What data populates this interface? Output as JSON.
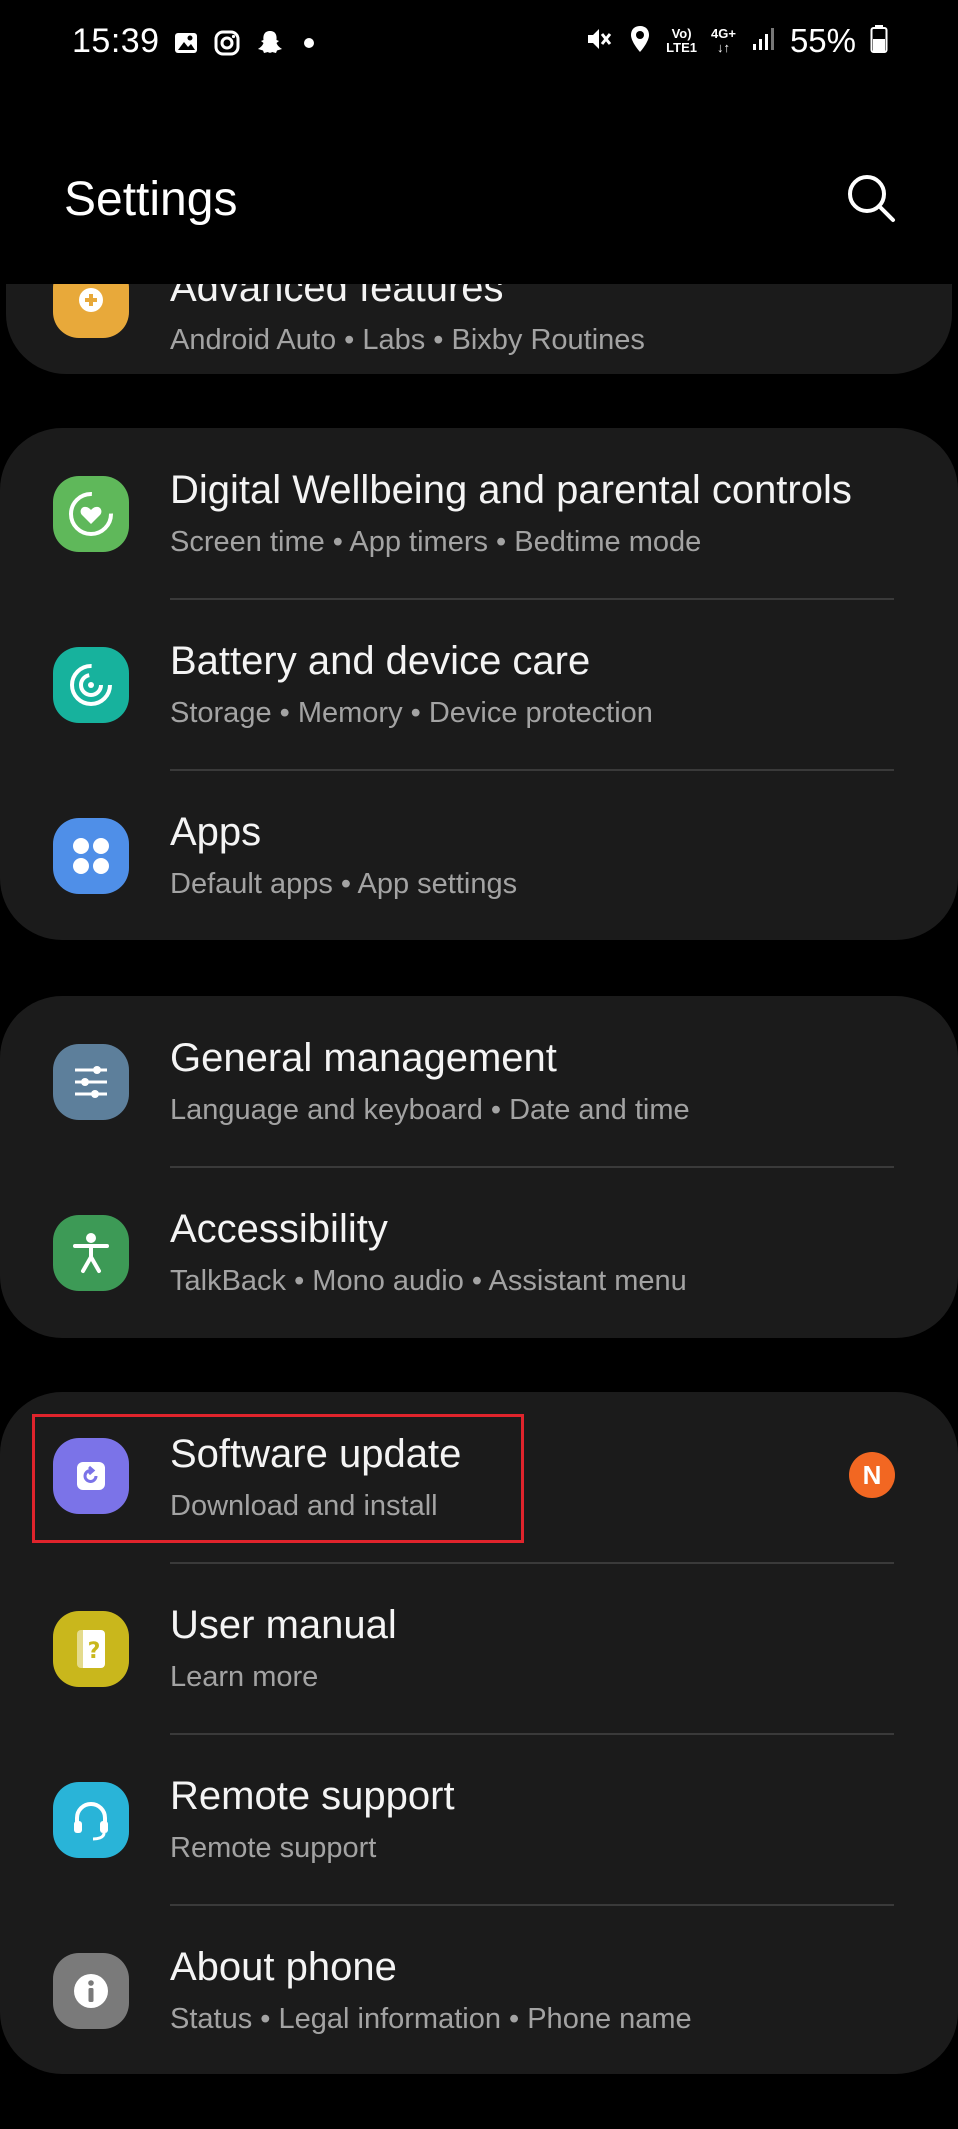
{
  "status_bar": {
    "time": "15:39",
    "battery_percent": "55%",
    "network_top": "Vo)",
    "network_bottom": "LTE1",
    "network_type": "4G+",
    "icons": [
      "gallery-icon",
      "instagram-icon",
      "snapchat-icon",
      "dot-icon",
      "mute-icon",
      "location-icon",
      "signal-icon",
      "battery-icon"
    ]
  },
  "header": {
    "title": "Settings"
  },
  "partial_item": {
    "title": "Advanced features",
    "subtitle": "Android Auto  •  Labs  •  Bixby Routines",
    "icon": "gear-plus-icon",
    "icon_color": "#e8a93a"
  },
  "groups": [
    {
      "items": [
        {
          "title": "Digital Wellbeing and parental controls",
          "subtitle": "Screen time  •  App timers  •  Bedtime mode",
          "icon": "wellbeing-icon",
          "icon_color": "#5fb85a"
        },
        {
          "title": "Battery and device care",
          "subtitle": "Storage  •  Memory  •  Device protection",
          "icon": "device-care-icon",
          "icon_color": "#17b29d"
        },
        {
          "title": "Apps",
          "subtitle": "Default apps  •  App settings",
          "icon": "apps-icon",
          "icon_color": "#4f8fe8"
        }
      ]
    },
    {
      "items": [
        {
          "title": "General management",
          "subtitle": "Language and keyboard  •  Date and time",
          "icon": "sliders-icon",
          "icon_color": "#5d7f9b"
        },
        {
          "title": "Accessibility",
          "subtitle": "TalkBack  •  Mono audio  •  Assistant menu",
          "icon": "accessibility-icon",
          "icon_color": "#3d9a56"
        }
      ]
    },
    {
      "items": [
        {
          "title": "Software update",
          "subtitle": "Download and install",
          "icon": "software-update-icon",
          "icon_color": "#7b73e8",
          "badge": "N",
          "badge_color": "#f26722"
        },
        {
          "title": "User manual",
          "subtitle": "Learn more",
          "icon": "manual-icon",
          "icon_color": "#c9b71c"
        },
        {
          "title": "Remote support",
          "subtitle": "Remote support",
          "icon": "headset-icon",
          "icon_color": "#29b4d8"
        },
        {
          "title": "About phone",
          "subtitle": "Status  •  Legal information  •  Phone name",
          "icon": "info-icon",
          "icon_color": "#7a7a7a"
        }
      ]
    }
  ],
  "highlight_color": "#e0242c"
}
